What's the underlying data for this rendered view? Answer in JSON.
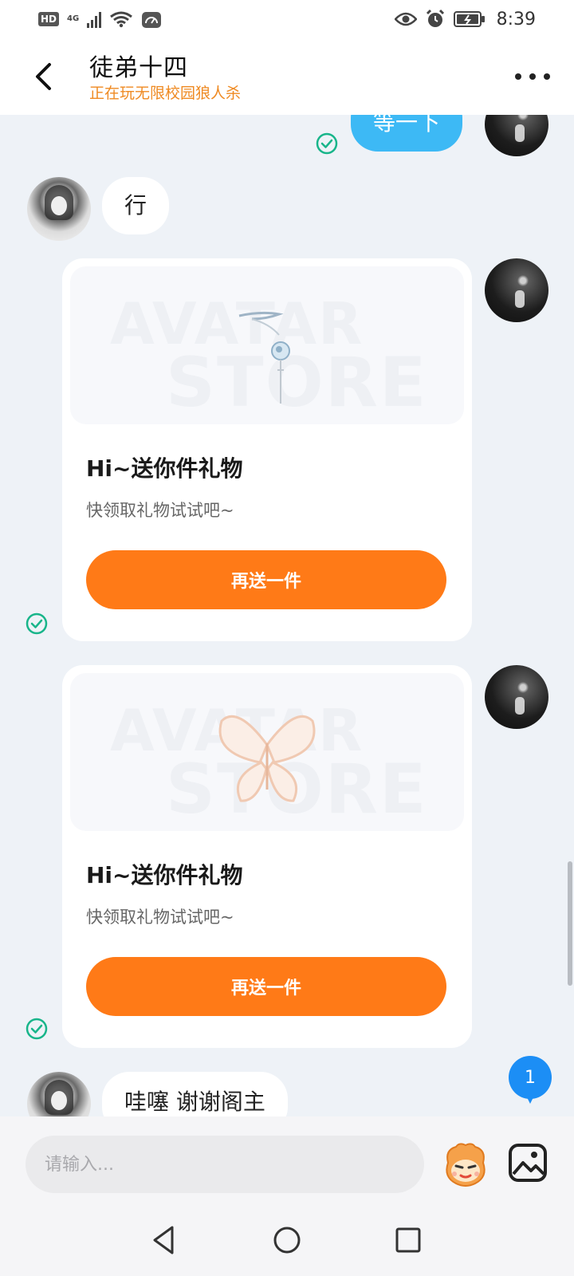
{
  "status_bar": {
    "hd_label": "HD",
    "network_label": "4G",
    "time": "8:39",
    "icons": [
      "hd-icon",
      "signal-icon",
      "wifi-icon",
      "speedometer-icon",
      "eye-icon",
      "alarm-icon",
      "battery-icon"
    ]
  },
  "header": {
    "contact_name": "徒弟十四",
    "contact_status": "正在玩无限校园狼人杀"
  },
  "messages": [
    {
      "sender": "self",
      "text": "等一下",
      "status": "sent"
    },
    {
      "sender": "other",
      "text": "行"
    },
    {
      "sender": "self",
      "type": "gift",
      "status": "sent",
      "title": "Hi~送你件礼物",
      "subtitle": "快领取礼物试试吧~",
      "button_label": "再送一件",
      "watermark_line1": "AVATAR",
      "watermark_line2": "STORE",
      "gift_item": "hairpin"
    },
    {
      "sender": "self",
      "type": "gift",
      "status": "sent",
      "title": "Hi~送你件礼物",
      "subtitle": "快领取礼物试试吧~",
      "button_label": "再送一件",
      "watermark_line1": "AVATAR",
      "watermark_line2": "STORE",
      "gift_item": "butterfly"
    },
    {
      "sender": "other",
      "text": "哇噻 谢谢阁主"
    }
  ],
  "unread_count": "1",
  "input": {
    "placeholder": "请输入..."
  },
  "colors": {
    "accent_orange": "#ff7a17",
    "status_orange": "#ef8a22",
    "bubble_blue": "#3db9f5",
    "check_green": "#18b58a",
    "badge_blue": "#1c8ef5"
  }
}
